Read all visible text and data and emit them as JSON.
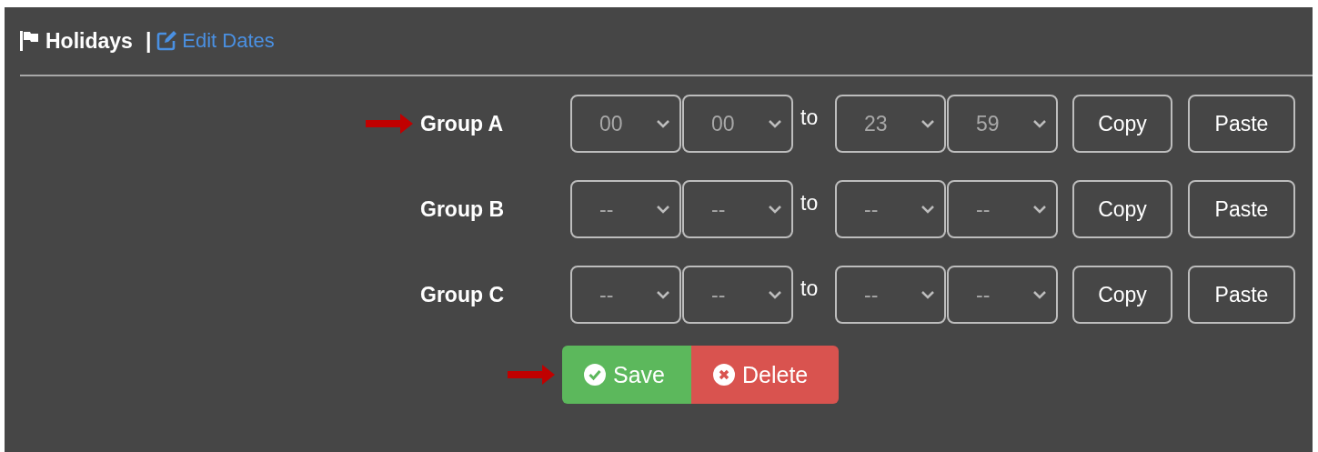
{
  "header": {
    "title": "Holidays",
    "separator": "|",
    "link": "Edit Dates"
  },
  "groups": [
    {
      "label": "Group A",
      "pointer": true,
      "start": [
        "00",
        "00"
      ],
      "connector": "to",
      "end": [
        "23",
        "59"
      ],
      "buttons": [
        "Copy",
        "Paste"
      ]
    },
    {
      "label": "Group B",
      "pointer": false,
      "start": [
        "--",
        "--"
      ],
      "connector": "to",
      "end": [
        "--",
        "--"
      ],
      "buttons": [
        "Copy",
        "Paste"
      ]
    },
    {
      "label": "Group C",
      "pointer": false,
      "start": [
        "--",
        "--"
      ],
      "connector": "to",
      "end": [
        "--",
        "--"
      ],
      "buttons": [
        "Copy",
        "Paste"
      ]
    }
  ],
  "actions": {
    "pointer": true,
    "buttons": [
      {
        "kind": "save",
        "label": "Save"
      },
      {
        "kind": "delete",
        "label": "Delete"
      }
    ]
  }
}
